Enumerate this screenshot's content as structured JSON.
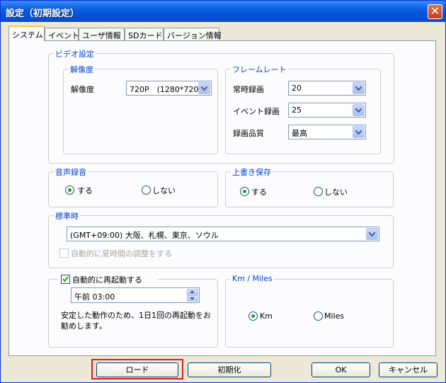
{
  "window": {
    "title": "設定（初期設定）"
  },
  "tabs": [
    {
      "label": "システム"
    },
    {
      "label": "イベント"
    },
    {
      "label": "ユーザ情報"
    },
    {
      "label": "SDカード"
    },
    {
      "label": "バージョン情報"
    }
  ],
  "video": {
    "title": "ビデオ設定",
    "resolution_group": "解像度",
    "resolution_label": "解像度",
    "resolution_value": "720P　(1280*720)",
    "framerate_group": "フレームレート",
    "constant_label": "常時録画",
    "constant_value": "20",
    "event_label": "イベント録画",
    "event_value": "25",
    "quality_label": "録画品質",
    "quality_value": "最高"
  },
  "audio": {
    "title": "音声録音",
    "on": "する",
    "off": "しない",
    "selected": "on"
  },
  "overwrite": {
    "title": "上書き保存",
    "on": "する",
    "off": "しない",
    "selected": "on"
  },
  "timezone": {
    "title": "標準時",
    "value": "(GMT+09:00) 大阪、札幌、東京、ソウル",
    "dst_label": "自動的に夏時間の調整をする",
    "dst_checked": false
  },
  "restart": {
    "label": "自動的に再起動する",
    "checked": true,
    "time": "午前  03:00",
    "note_line1": "安定した動作のため、1日1回の再起動をお",
    "note_line2": "勧めします。"
  },
  "units": {
    "title": "Km / Miles",
    "km": "Km",
    "miles": "Miles",
    "selected": "km"
  },
  "buttons": {
    "load": "ロード",
    "init": "初期化",
    "ok": "OK",
    "cancel": "キャンセル"
  },
  "colors": {
    "titlebar": "#0a5fe0",
    "group_label": "#0046d5",
    "highlight": "#e01e1e",
    "radio_dot": "#21a121"
  }
}
